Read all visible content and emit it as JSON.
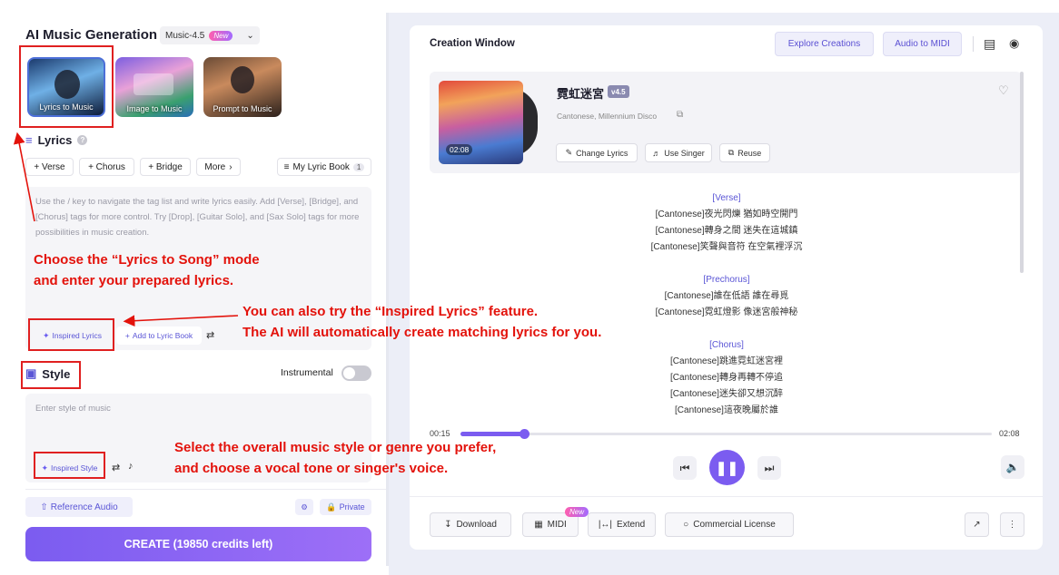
{
  "app": {
    "title": "AI Music Generation",
    "model": "Music-4.5",
    "new_badge": "New"
  },
  "modes": [
    {
      "label": "Lyrics to Music"
    },
    {
      "label": "Image to Music"
    },
    {
      "label": "Prompt to Music"
    }
  ],
  "lyrics": {
    "heading": "Lyrics",
    "chips": [
      "+ Verse",
      "+ Chorus",
      "+ Bridge",
      "More"
    ],
    "lyric_book": "My Lyric Book",
    "lyric_book_count": "1",
    "placeholder": "Use the / key to navigate the tag list and write lyrics easily. Add [Verse], [Bridge], and [Chorus] tags for more control. Try [Drop], [Guitar Solo], and [Sax Solo] tags for more possibilities in music creation.",
    "inspired": "Inspired Lyrics",
    "add_book": "Add to Lyric Book"
  },
  "style": {
    "heading": "Style",
    "instrumental": "Instrumental",
    "placeholder": "Enter style of music",
    "inspired": "Inspired Style"
  },
  "bottom_left": {
    "reference_audio": "Reference Audio",
    "private": "Private",
    "create": "CREATE (19850 credits left)"
  },
  "annotations": {
    "a1_line1": "Choose the “Lyrics to Song” mode",
    "a1_line2": "and enter your prepared lyrics.",
    "a2_line1": "You can also try the “Inspired Lyrics” feature.",
    "a2_line2": "The AI will automatically create matching lyrics for you.",
    "a3_line1": "Select the overall music style or genre you prefer,",
    "a3_line2": "and choose a vocal tone or singer's voice."
  },
  "creation": {
    "title": "Creation Window",
    "explore": "Explore Creations",
    "audio_to_midi": "Audio to MIDI"
  },
  "song": {
    "title": "霓虹迷宮",
    "version": "v4.5",
    "tags": "Cantonese, Millennium Disco",
    "duration": "02:08",
    "actions": [
      "Change Lyrics",
      "Use Singer",
      "Reuse"
    ]
  },
  "song_lyrics": [
    {
      "type": "tag",
      "text": "[Verse]"
    },
    {
      "type": "line",
      "text": "[Cantonese]夜光閃爍 猶如時空開門"
    },
    {
      "type": "line",
      "text": "[Cantonese]轉身之間 迷失在這城鎮"
    },
    {
      "type": "line",
      "text": "[Cantonese]笑聲與音符 在空氣裡浮沉"
    },
    {
      "type": "gap",
      "text": ""
    },
    {
      "type": "tag",
      "text": "[Prechorus]"
    },
    {
      "type": "line",
      "text": "[Cantonese]誰在低語 誰在尋覓"
    },
    {
      "type": "line",
      "text": "[Cantonese]霓虹燈影 像迷宮般神秘"
    },
    {
      "type": "gap",
      "text": ""
    },
    {
      "type": "tag",
      "text": "[Chorus]"
    },
    {
      "type": "line",
      "text": "[Cantonese]跳進霓虹迷宮裡"
    },
    {
      "type": "line",
      "text": "[Cantonese]轉身再轉不停追"
    },
    {
      "type": "line",
      "text": "[Cantonese]迷失卻又想沉醉"
    },
    {
      "type": "line",
      "text": "[Cantonese]這夜晚屬於誰"
    }
  ],
  "player": {
    "current": "00:15",
    "total": "02:08",
    "progress": 0.12
  },
  "bottom_actions": {
    "download": "Download",
    "midi": "MIDI",
    "midi_badge": "New",
    "extend": "Extend",
    "license": "Commercial License"
  },
  "colors": {
    "accent": "#7b5cf0",
    "annotation": "#e3120b"
  }
}
